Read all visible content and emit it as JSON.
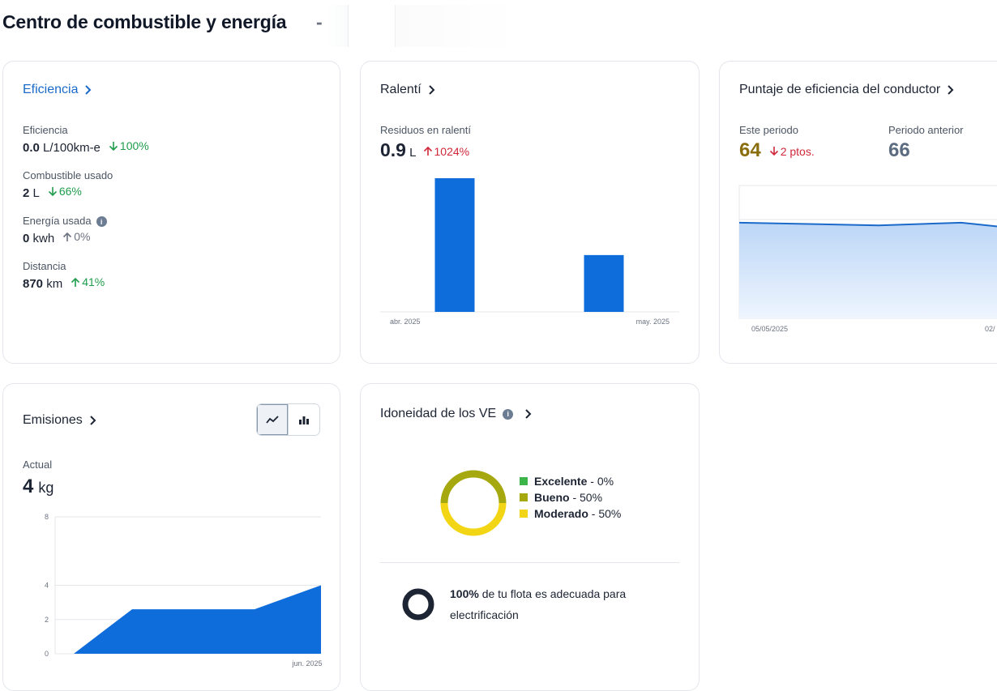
{
  "page": {
    "title": "Centro de combustible y energía",
    "title_dash": "-"
  },
  "efficiency_card": {
    "header": "Eficiencia",
    "metrics": [
      {
        "label": "Eficiencia",
        "value": "0.0",
        "unit": "L/100km-e",
        "delta": "100%",
        "direction": "down",
        "color": "green"
      },
      {
        "label": "Combustible usado",
        "value": "2",
        "unit": "L",
        "delta": "66%",
        "direction": "down",
        "color": "green"
      },
      {
        "label": "Energía usada",
        "value": "0",
        "unit": "kwh",
        "delta": "0%",
        "direction": "up",
        "color": "gray"
      },
      {
        "label": "Distancia",
        "value": "870",
        "unit": "km",
        "delta": "41%",
        "direction": "up",
        "color": "green"
      }
    ]
  },
  "idle_card": {
    "header": "Ralentí",
    "metric_label": "Residuos en ralentí",
    "value": "0.9",
    "unit": "L",
    "delta": "1024%",
    "delta_direction": "up",
    "x_tick_start": "abr. 2025",
    "x_tick_end": "may. 2025"
  },
  "driver_card": {
    "header": "Puntaje de eficiencia del conductor",
    "current_label": "Este periodo",
    "current_value": "64",
    "delta": "2 ptos.",
    "delta_direction": "down",
    "previous_label": "Periodo anterior",
    "previous_value": "66",
    "x_tick_start": "05/05/2025",
    "x_tick_end": "02/"
  },
  "emissions_card": {
    "header": "Emisiones",
    "metric_label": "Actual",
    "value": "4",
    "unit": "kg",
    "y_ticks": [
      "8",
      "4",
      "2",
      "0"
    ],
    "x_tick": "jun. 2025",
    "toggle": {
      "selected": "line"
    }
  },
  "ev_card": {
    "header": "Idoneidad de los VE",
    "legend": [
      {
        "name": "Excelente",
        "value": "0%",
        "color": "#3bb54a"
      },
      {
        "name": "Bueno",
        "value": "50%",
        "color": "#a6a80f"
      },
      {
        "name": "Moderado",
        "value": "50%",
        "color": "#f2d616"
      }
    ],
    "summary_bold": "100%",
    "summary_text": "de tu flota es adecuada para electrificación"
  },
  "colors": {
    "accent_blue": "#0f6ddb",
    "link_blue": "#1b6ac9",
    "score_gold": "#8a6d0c",
    "previous_gray": "#5c6b80"
  },
  "chart_data": [
    {
      "type": "bar",
      "categories": [
        "abr. 2025",
        "may. 2025"
      ],
      "values": [
        0.8,
        0.34
      ],
      "xlabel": "",
      "ylabel": ""
    },
    {
      "type": "area",
      "x": [
        "05/05/2025",
        "",
        "",
        "02/"
      ],
      "values": [
        66,
        65,
        66,
        64.5
      ],
      "ylim": [
        30,
        80
      ],
      "xlabel": "",
      "ylabel": ""
    },
    {
      "type": "area",
      "x": [
        "",
        "",
        "",
        "jun. 2025"
      ],
      "values": [
        0,
        2.6,
        2.6,
        4
      ],
      "yticks": [
        0,
        2,
        4,
        8
      ],
      "ylim": [
        0,
        8
      ],
      "xlabel": "",
      "ylabel": ""
    },
    {
      "type": "pie",
      "categories": [
        "Excelente",
        "Bueno",
        "Moderado"
      ],
      "values": [
        0,
        50,
        50
      ]
    }
  ]
}
